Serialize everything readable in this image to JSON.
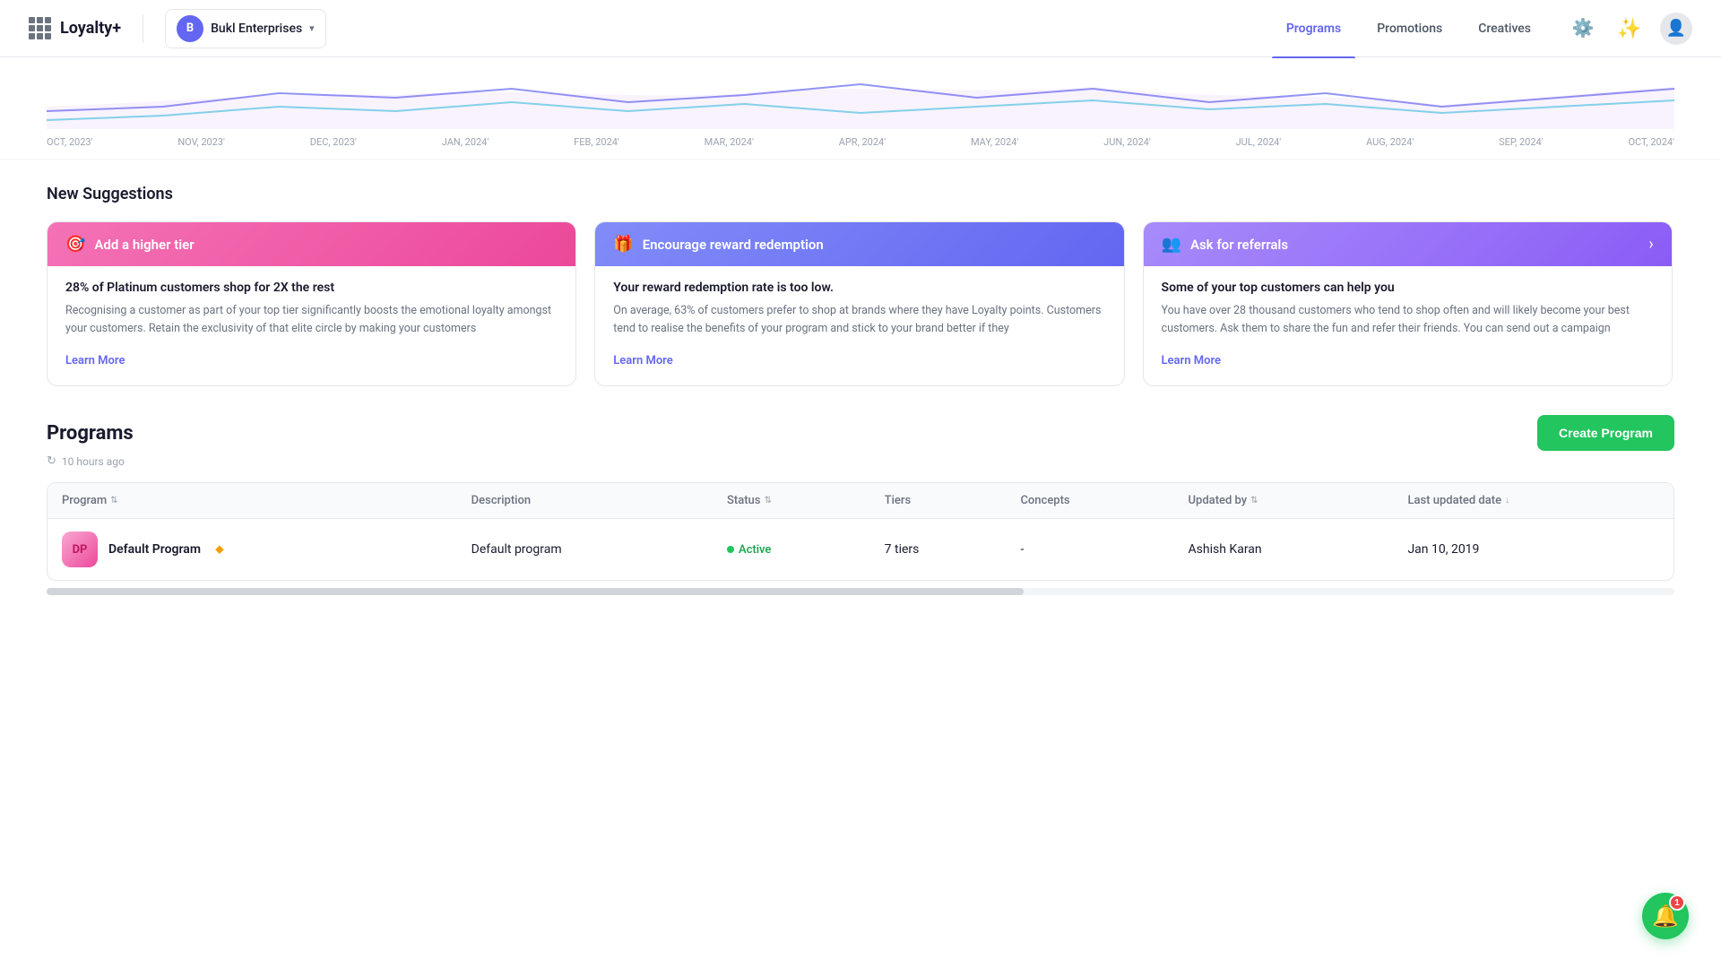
{
  "app": {
    "name": "Loyalty+",
    "company": {
      "initial": "B",
      "name": "Bukl Enterprises"
    }
  },
  "nav": {
    "links": [
      {
        "id": "programs",
        "label": "Programs",
        "active": true
      },
      {
        "id": "promotions",
        "label": "Promotions",
        "active": false
      },
      {
        "id": "creatives",
        "label": "Creatives",
        "active": false
      }
    ]
  },
  "chart": {
    "labels": [
      "OCT, 2023'",
      "NOV, 2023'",
      "DEC, 2023'",
      "JAN, 2024'",
      "FEB, 2024'",
      "MAR, 2024'",
      "APR, 2024'",
      "MAY, 2024'",
      "JUN, 2024'",
      "JUL, 2024'",
      "AUG, 2024'",
      "SEP, 2024'",
      "OCT, 2024'"
    ]
  },
  "suggestions": {
    "section_title": "New Suggestions",
    "cards": [
      {
        "id": "card1",
        "header_style": "pink",
        "icon": "🎯",
        "title": "Add a higher tier",
        "highlight": "28% of Platinum customers shop for 2X the rest",
        "text": "Recognising a customer as part of your top tier significantly boosts the emotional loyalty amongst your customers. Retain the exclusivity of that elite circle by making your customers",
        "learn_more": "Learn More"
      },
      {
        "id": "card2",
        "header_style": "blue",
        "icon": "🎁",
        "title": "Encourage reward redemption",
        "highlight": "Your reward redemption rate is too low.",
        "text": "On average, 63% of customers prefer to shop at brands where they have Loyalty points. Customers tend to realise the benefits of your program and stick to your brand better if they",
        "learn_more": "Learn More"
      },
      {
        "id": "card3",
        "header_style": "purple",
        "icon": "👥",
        "title": "Ask for referrals",
        "highlight": "Some of your top customers can help you",
        "text": "You have over 28 thousand customers who tend to shop often and will likely become your best customers. Ask them to share the fun and refer their friends. You can send out a campaign",
        "learn_more": "Learn More"
      }
    ]
  },
  "programs": {
    "section_title": "Programs",
    "last_updated": "10 hours ago",
    "create_button": "Create Program",
    "table": {
      "columns": [
        {
          "id": "program",
          "label": "Program",
          "sortable": true
        },
        {
          "id": "description",
          "label": "Description",
          "sortable": false
        },
        {
          "id": "status",
          "label": "Status",
          "sortable": true
        },
        {
          "id": "tiers",
          "label": "Tiers",
          "sortable": false
        },
        {
          "id": "concepts",
          "label": "Concepts",
          "sortable": false
        },
        {
          "id": "updated_by",
          "label": "Updated by",
          "sortable": true
        },
        {
          "id": "last_updated_date",
          "label": "Last updated date",
          "sortable": true
        }
      ],
      "rows": [
        {
          "id": "row1",
          "avatar_text": "DP",
          "name": "Default Program",
          "is_default": true,
          "description": "Default program",
          "status": "Active",
          "tiers": "7 tiers",
          "concepts": "-",
          "updated_by": "Ashish Karan",
          "last_updated_date": "Jan 10, 2019"
        }
      ]
    }
  },
  "notifications": {
    "count": "1"
  }
}
